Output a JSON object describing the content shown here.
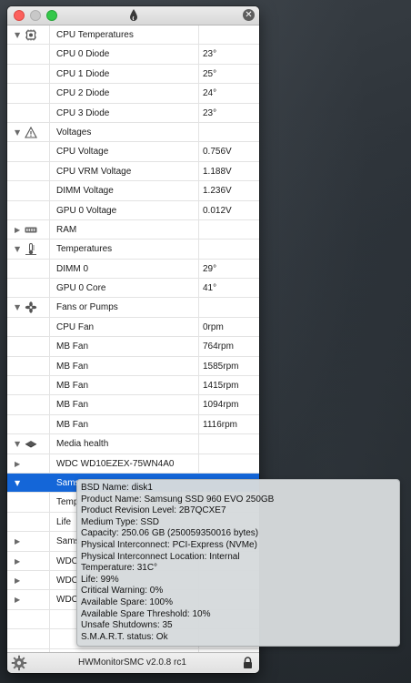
{
  "window": {
    "app_title": "HWMonitorSMC v2.0.8 rc1"
  },
  "rows": [
    {
      "kind": "group",
      "disclosure": "▼",
      "icon": "cpu-icon",
      "name": "CPU Temperatures",
      "value": ""
    },
    {
      "kind": "item",
      "name": "CPU 0 Diode",
      "value": "23°"
    },
    {
      "kind": "item",
      "name": "CPU 1 Diode",
      "value": "25°"
    },
    {
      "kind": "item",
      "name": "CPU 2 Diode",
      "value": "24°"
    },
    {
      "kind": "item",
      "name": "CPU 3 Diode",
      "value": "23°"
    },
    {
      "kind": "group",
      "disclosure": "▼",
      "icon": "warning-icon",
      "name": "Voltages",
      "value": ""
    },
    {
      "kind": "item",
      "name": "CPU Voltage",
      "value": "0.756V"
    },
    {
      "kind": "item",
      "name": "CPU VRM Voltage",
      "value": "1.188V"
    },
    {
      "kind": "item",
      "name": "DIMM Voltage",
      "value": "1.236V"
    },
    {
      "kind": "item",
      "name": "GPU 0 Voltage",
      "value": "0.012V"
    },
    {
      "kind": "group",
      "disclosure": "▶",
      "icon": "ram-icon",
      "name": "RAM",
      "value": ""
    },
    {
      "kind": "group",
      "disclosure": "▼",
      "icon": "thermometer-icon",
      "name": "Temperatures",
      "value": ""
    },
    {
      "kind": "item",
      "name": "DIMM 0",
      "value": "29°"
    },
    {
      "kind": "item",
      "name": "GPU 0 Core",
      "value": "41°"
    },
    {
      "kind": "group",
      "disclosure": "▼",
      "icon": "fan-icon",
      "name": "Fans or Pumps",
      "value": ""
    },
    {
      "kind": "item",
      "name": "CPU Fan",
      "value": "0rpm"
    },
    {
      "kind": "item",
      "name": "MB Fan",
      "value": "764rpm"
    },
    {
      "kind": "item",
      "name": "MB Fan",
      "value": "1585rpm"
    },
    {
      "kind": "item",
      "name": "MB Fan",
      "value": "1415rpm"
    },
    {
      "kind": "item",
      "name": "MB Fan",
      "value": "1094rpm"
    },
    {
      "kind": "item",
      "name": "MB Fan",
      "value": "1116rpm"
    },
    {
      "kind": "group",
      "disclosure": "▼",
      "icon": "disk-icon",
      "name": "Media health",
      "value": ""
    },
    {
      "kind": "item",
      "disclosure": "▶",
      "name": "WDC WD10EZEX-75WN4A0",
      "value": ""
    },
    {
      "kind": "item",
      "disclosure": "▼",
      "name": "Sams",
      "value": "",
      "selected": true
    },
    {
      "kind": "item",
      "name": "Temp",
      "value": ""
    },
    {
      "kind": "item",
      "name": "Life",
      "value": ""
    },
    {
      "kind": "item",
      "disclosure": "▶",
      "name": "Sams",
      "value": ""
    },
    {
      "kind": "item",
      "disclosure": "▶",
      "name": "WDC",
      "value": ""
    },
    {
      "kind": "item",
      "disclosure": "▶",
      "name": "WDC",
      "value": ""
    },
    {
      "kind": "item",
      "disclosure": "▶",
      "name": "WDC",
      "value": ""
    },
    {
      "kind": "blank",
      "name": "",
      "value": ""
    },
    {
      "kind": "blank",
      "name": "",
      "value": ""
    },
    {
      "kind": "blank",
      "name": "",
      "value": ""
    }
  ],
  "tooltip": {
    "lines": [
      "BSD Name: disk1",
      "Product Name: Samsung SSD 960 EVO 250GB",
      "Product Revision Level: 2B7QCXE7",
      "Medium Type: SSD",
      "Capacity: 250.06 GB (250059350016 bytes)",
      "Physical Interconnect: PCI-Express (NVMe)",
      "Physical Interconnect Location: Internal",
      "Temperature: 31C°",
      "Life: 99%",
      "Critical Warning: 0%",
      "Available Spare: 100%",
      "Available Spare Threshold: 10%",
      "Unsafe Shutdowns: 35",
      "S.M.A.R.T. status: Ok"
    ]
  },
  "icons": {
    "close": "close-icon",
    "minimize": "minimize-icon",
    "zoom": "zoom-icon",
    "drop": "drop-icon",
    "dismiss": "x-circle-icon",
    "gear": "gear-icon",
    "lock": "lock-icon"
  },
  "colors": {
    "selection": "#1466d8",
    "close": "#fc605c",
    "zoom": "#34c84a"
  }
}
